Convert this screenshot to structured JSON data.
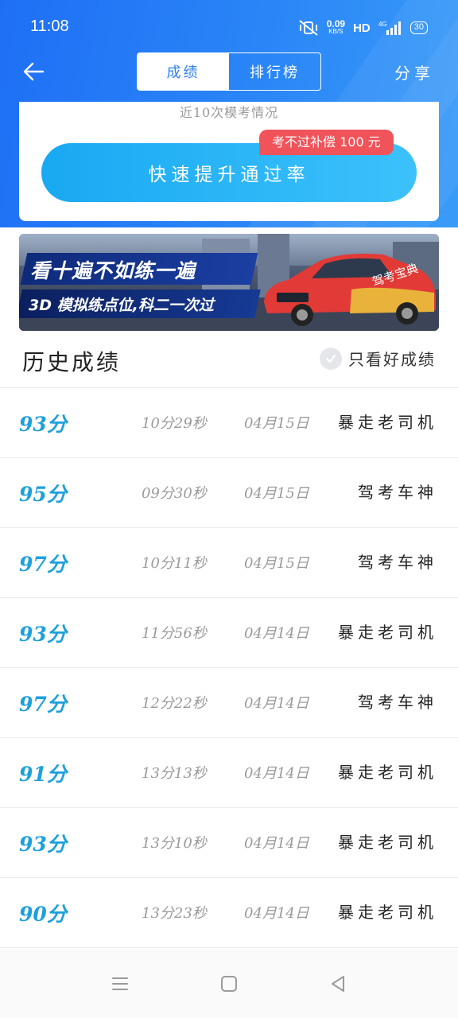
{
  "status_bar": {
    "time": "11:08",
    "net_speed": "0.09",
    "net_unit": "KB/S",
    "hd": "HD",
    "network": "4G",
    "battery": "30"
  },
  "nav": {
    "tabs": [
      {
        "label": "成绩",
        "active": true
      },
      {
        "label": "排行榜",
        "active": false
      }
    ],
    "share_label": "分享"
  },
  "summary_card": {
    "caption": "近10次模考情况",
    "boost_label": "快速提升通过率",
    "promo_badge": "考不过补偿 100 元"
  },
  "banner": {
    "line1": "看十遍不如练一遍",
    "line2": "3D 模拟练点位,科二一次过",
    "car_text": "驾考宝典"
  },
  "history": {
    "title": "历史成绩",
    "filter_label": "只看好成绩",
    "rows": [
      {
        "score": "93分",
        "duration": "10分29秒",
        "date": "04月15日",
        "rank": "暴走老司机"
      },
      {
        "score": "95分",
        "duration": "09分30秒",
        "date": "04月15日",
        "rank": "驾考车神"
      },
      {
        "score": "97分",
        "duration": "10分11秒",
        "date": "04月15日",
        "rank": "驾考车神"
      },
      {
        "score": "93分",
        "duration": "11分56秒",
        "date": "04月14日",
        "rank": "暴走老司机"
      },
      {
        "score": "97分",
        "duration": "12分22秒",
        "date": "04月14日",
        "rank": "驾考车神"
      },
      {
        "score": "91分",
        "duration": "13分13秒",
        "date": "04月14日",
        "rank": "暴走老司机"
      },
      {
        "score": "93分",
        "duration": "13分10秒",
        "date": "04月14日",
        "rank": "暴走老司机"
      },
      {
        "score": "90分",
        "duration": "13分23秒",
        "date": "04月14日",
        "rank": "暴走老司机"
      }
    ]
  },
  "colors": {
    "header_blue": "#2a86f7",
    "score_blue": "#1ea0db",
    "promo_red": "#f0535a"
  },
  "icons": {
    "back": "arrow-left-icon",
    "filter": "check-circle-icon",
    "sys_menu": "menu-icon",
    "sys_home": "square-home-icon",
    "sys_back": "triangle-back-icon"
  }
}
